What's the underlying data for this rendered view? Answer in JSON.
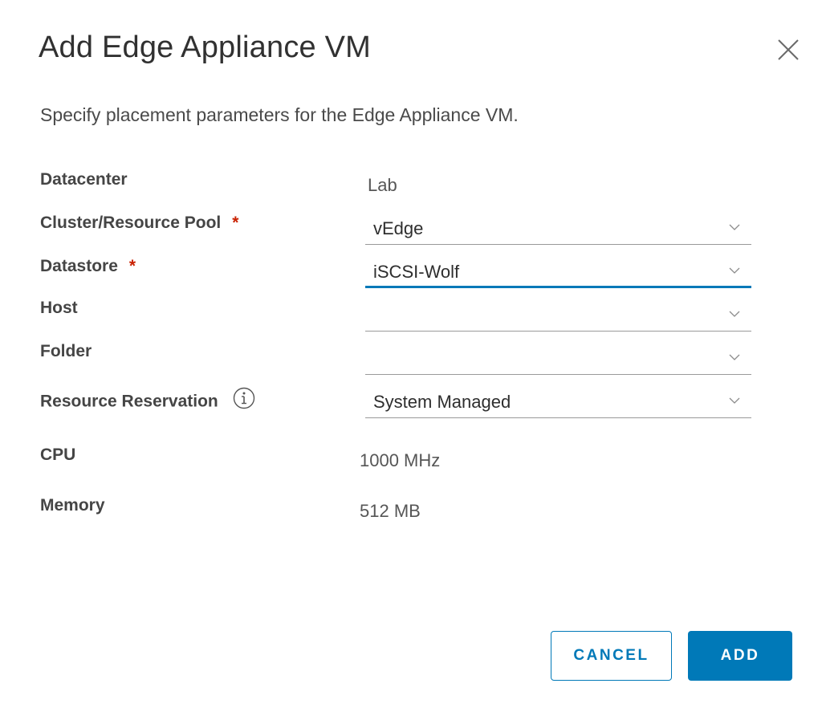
{
  "dialog": {
    "title": "Add Edge Appliance VM",
    "description": "Specify placement parameters for the Edge Appliance VM."
  },
  "fields": {
    "datacenter": {
      "label": "Datacenter",
      "value": "Lab"
    },
    "cluster": {
      "label": "Cluster/Resource Pool",
      "required_mark": "*",
      "value": "vEdge"
    },
    "datastore": {
      "label": "Datastore",
      "required_mark": "*",
      "value": "iSCSI-Wolf"
    },
    "host": {
      "label": "Host",
      "value": ""
    },
    "folder": {
      "label": "Folder",
      "value": ""
    },
    "reservation": {
      "label": "Resource Reservation",
      "value": "System Managed"
    },
    "cpu": {
      "label": "CPU",
      "value": "1000 MHz"
    },
    "memory": {
      "label": "Memory",
      "value": "512 MB"
    }
  },
  "buttons": {
    "cancel": "CANCEL",
    "add": "ADD"
  },
  "icons": {
    "close": "close-icon",
    "chevron": "chevron-down-icon",
    "info": "info-icon"
  },
  "colors": {
    "primary": "#0079b8",
    "required": "#c92100",
    "focus_underline": "#0079b8"
  }
}
